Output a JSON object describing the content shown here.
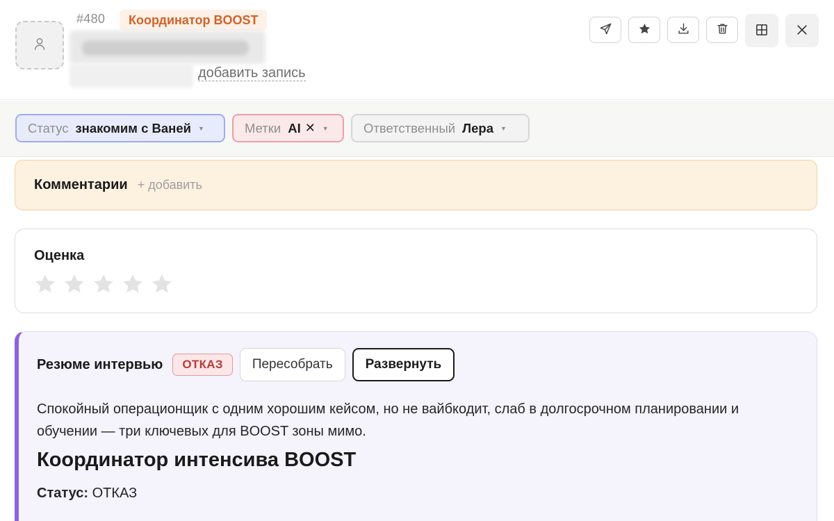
{
  "header": {
    "candidate_id": "#480",
    "vacancy_badge": "Координатор BOOST",
    "add_record_link": "добавить запись"
  },
  "actions": [
    {
      "icon": "send-icon"
    },
    {
      "icon": "star-icon"
    },
    {
      "icon": "download-icon"
    },
    {
      "icon": "trash-icon"
    },
    {
      "icon": "grid-icon"
    },
    {
      "icon": "close-icon"
    }
  ],
  "filters": {
    "status": {
      "label": "Статус",
      "value": "знакомим с Ваней"
    },
    "tags": {
      "label": "Метки",
      "value": "AI"
    },
    "owner": {
      "label": "Ответственный",
      "value": "Лера"
    }
  },
  "comments": {
    "title": "Комментарии",
    "add_label": "+ добавить"
  },
  "rating": {
    "title": "Оценка",
    "value": 0,
    "max": 5
  },
  "summary": {
    "title": "Резюме интервью",
    "badge": "ОТКАЗ",
    "rebuild_label": "Пересобрать",
    "expand_label": "Развернуть",
    "text": "Спокойный операционщик с одним хорошим кейсом, но не вайбкодит, слаб в долгосрочном планировании и обучении — три ключевых для BOOST зоны мимо.",
    "heading": "Координатор интенсива BOOST",
    "status_label": "Статус:",
    "status_value": "ОТКАЗ"
  },
  "colors": {
    "accent_purple": "#8d62e0",
    "status_chip_border": "#9eabee",
    "tags_chip_border": "#ee9fa3",
    "vacancy_orange": "#d0632a",
    "reject_red": "#b83a3a",
    "comments_bg": "#fdf1e0"
  }
}
